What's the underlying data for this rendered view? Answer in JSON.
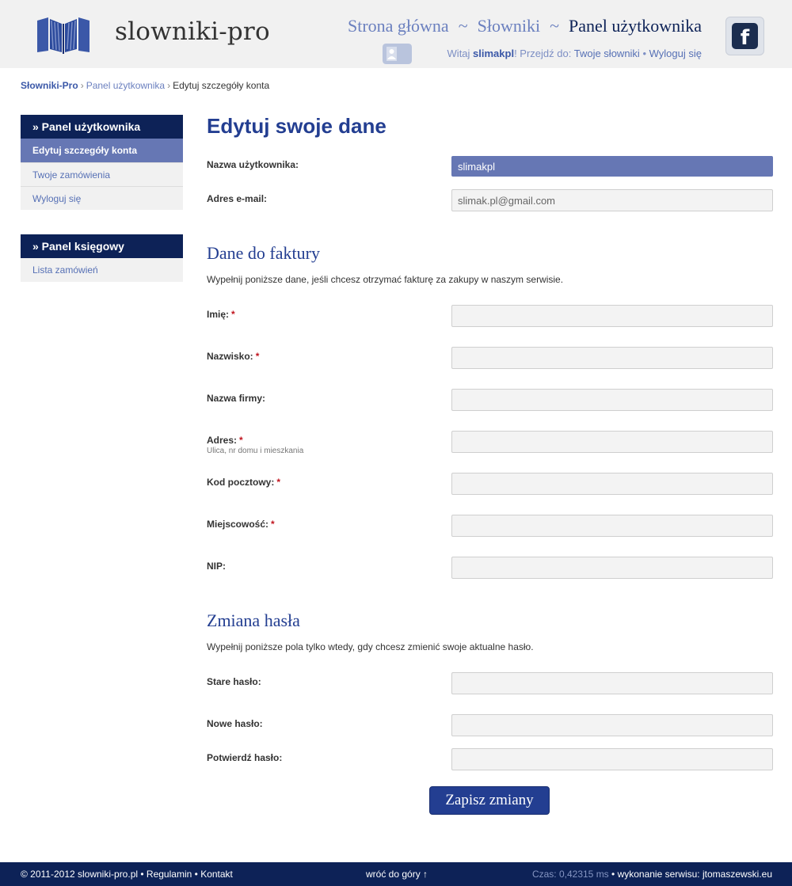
{
  "header": {
    "logo_text": "slowniki-pro",
    "nav": [
      {
        "label": "Strona główna"
      },
      {
        "label": "Słowniki"
      },
      {
        "label": "Panel użytkownika",
        "current": true
      }
    ],
    "nav_separator": "~",
    "user_line": {
      "welcome": "Witaj",
      "username": "slimakpl",
      "goto": "! Przejdź do:",
      "link_dictionaries": "Twoje słowniki",
      "bullet": "•",
      "link_logout": "Wyloguj się"
    },
    "facebook_icon": "facebook-icon"
  },
  "breadcrumb": {
    "home": "Słowniki-Pro",
    "separator": "›",
    "panel": "Panel użytkownika",
    "current": "Edytuj szczegóły konta"
  },
  "sidebar": {
    "user_panel": {
      "title": "» Panel użytkownika",
      "items": [
        {
          "label": "Edytuj szczegóły konta",
          "active": true
        },
        {
          "label": "Twoje zamówienia"
        },
        {
          "label": "Wyloguj się"
        }
      ]
    },
    "accounting_panel": {
      "title": "» Panel księgowy",
      "items": [
        {
          "label": "Lista zamówień"
        }
      ]
    }
  },
  "main": {
    "title": "Edytuj swoje dane",
    "account": {
      "username_label": "Nazwa użytkownika:",
      "username_value": "slimakpl",
      "email_label": "Adres e-mail:",
      "email_value": "slimak.pl@gmail.com"
    },
    "invoice": {
      "title": "Dane do faktury",
      "description": "Wypełnij poniższe dane, jeśli chcesz otrzymać fakturę za zakupy w naszym serwisie.",
      "required_mark": "*",
      "fields": {
        "first_name": {
          "label": "Imię:",
          "value": ""
        },
        "last_name": {
          "label": "Nazwisko:",
          "value": ""
        },
        "company": {
          "label": "Nazwa firmy:",
          "value": ""
        },
        "address": {
          "label": "Adres:",
          "hint": "Ulica, nr domu i mieszkania",
          "value": ""
        },
        "postal_code": {
          "label": "Kod pocztowy:",
          "value": ""
        },
        "city": {
          "label": "Miejscowość:",
          "value": ""
        },
        "nip": {
          "label": "NIP:",
          "value": ""
        }
      }
    },
    "password": {
      "title": "Zmiana hasła",
      "description": "Wypełnij poniższe pola tylko wtedy, gdy chcesz zmienić swoje aktualne hasło.",
      "old_label": "Stare hasło:",
      "new_label": "Nowe hasło:",
      "confirm_label": "Potwierdź hasło:"
    },
    "save_label": "Zapisz zmiany"
  },
  "footer": {
    "copyright": "© 2011-2012 slowniki-pro.pl",
    "bullet": "•",
    "terms": "Regulamin",
    "contact": "Kontakt",
    "back_to_top": "wróć do góry ↑",
    "time_text": "Czas: 0,42315 ms",
    "credit_prefix": "• wykonanie serwisu:",
    "credit_link": "jtomaszewski.eu"
  },
  "colors": {
    "navy": "#0d2257",
    "title_blue": "#233e91",
    "link_blue": "#6b80bf",
    "active_item": "#6677b4",
    "required_red": "#c0141e"
  }
}
